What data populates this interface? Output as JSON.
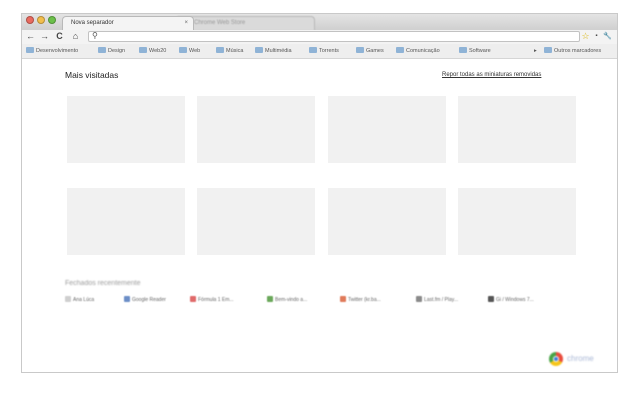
{
  "browser": {
    "tabs": [
      {
        "title": "Nova separador",
        "close": "×"
      },
      {
        "title": "Chrome Web Store"
      }
    ],
    "traffic_lights": [
      "#e96a5f",
      "#f2be4c",
      "#6cc04a"
    ],
    "nav_icons": [
      "back-icon",
      "forward-icon",
      "reload-icon",
      "home-icon",
      "search-icon",
      "star-icon",
      "page-icon",
      "wrench-icon"
    ],
    "nav_glyphs": {
      "back": "←",
      "forward": "→",
      "reload": "C",
      "home": "⌂",
      "search": "⚲",
      "star": "☆",
      "page": "▪",
      "wrench": "🔧"
    }
  },
  "bookmarks": {
    "items": [
      "Desenvolvimento",
      "Design",
      "Web20",
      "Web",
      "Música",
      "Multimédia",
      "Torrents",
      "Games",
      "Comunicação",
      "Software"
    ],
    "other_label": "Outros marcadores",
    "overflow_glyph": "▸"
  },
  "page": {
    "most_visited_title": "Mais visitadas",
    "restore_link": "Repor todas as miniaturas removidas",
    "recently_closed_title": "Fechados recentemente",
    "recent_items": [
      "Ana Lúca",
      "Google Reader",
      "Fórmula 1 Em...",
      "Bem-vindo a...",
      "Twitter (kr.ba...",
      "Last.fm / Play...",
      "Gi / Windows 7..."
    ],
    "recent_icon_colors": [
      "#cfcfcf",
      "#6c8ec7",
      "#e06a6a",
      "#6aa85a",
      "#e07a5a",
      "#8a8a8a",
      "#555555"
    ]
  },
  "logo": {
    "text": "chrome"
  }
}
